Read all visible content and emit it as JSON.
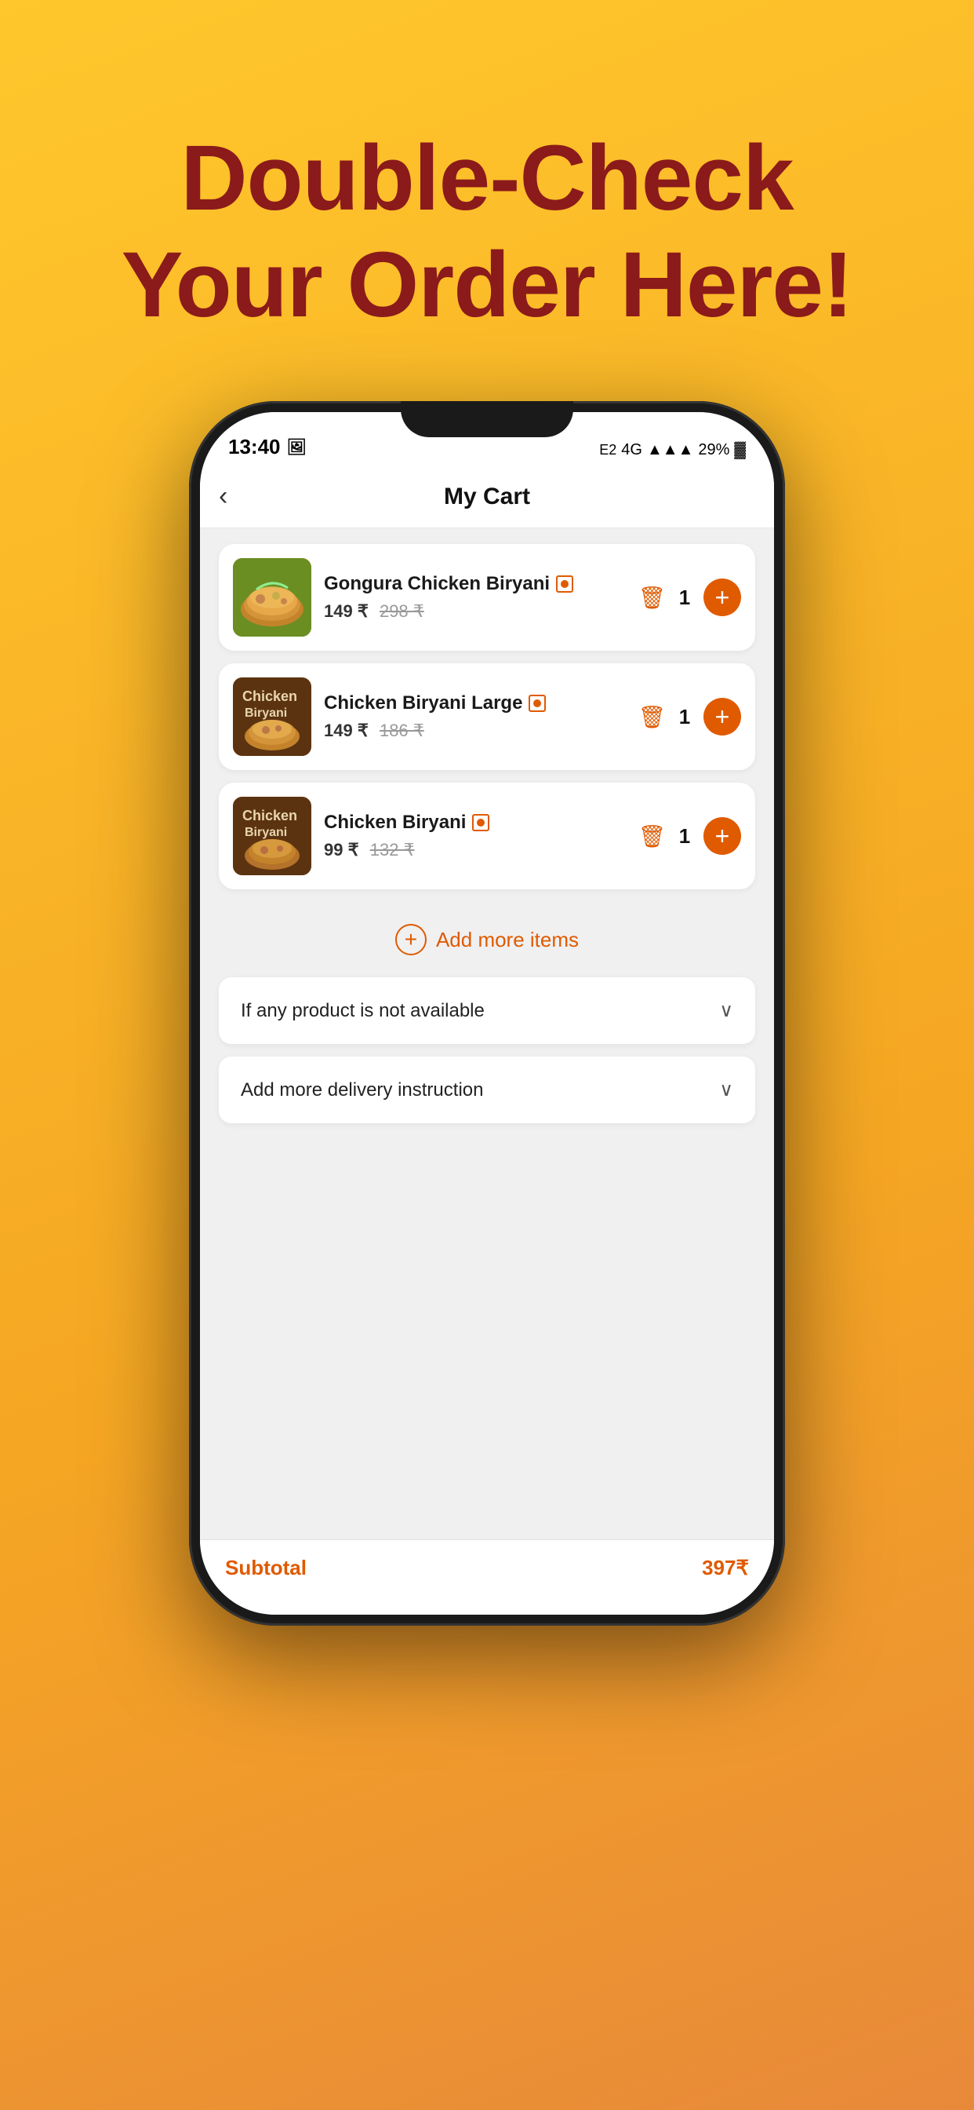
{
  "hero": {
    "title_line1": "Double-Check",
    "title_line2": "Your Order Here!"
  },
  "status_bar": {
    "time": "13:40",
    "photo_icon": "🖼",
    "network": "4G",
    "battery": "29%"
  },
  "nav": {
    "back_label": "‹",
    "title": "My Cart"
  },
  "cart_items": [
    {
      "name": "Gongura Chicken Biryani",
      "current_price": "149 ₹",
      "original_price": "298 ₹",
      "quantity": "1",
      "image_type": "biryani_green"
    },
    {
      "name": "Chicken Biryani Large",
      "current_price": "149 ₹",
      "original_price": "186 ₹",
      "quantity": "1",
      "image_type": "biryani_brown"
    },
    {
      "name": "Chicken Biryani",
      "current_price": "99 ₹",
      "original_price": "132 ₹",
      "quantity": "1",
      "image_type": "biryani_brown2"
    }
  ],
  "add_more": {
    "label": "Add more items"
  },
  "dropdowns": {
    "availability": "If any product is not available",
    "delivery": "Add more delivery instruction"
  },
  "bottom": {
    "subtotal_label": "Subtotal",
    "subtotal_value": "397₹"
  }
}
